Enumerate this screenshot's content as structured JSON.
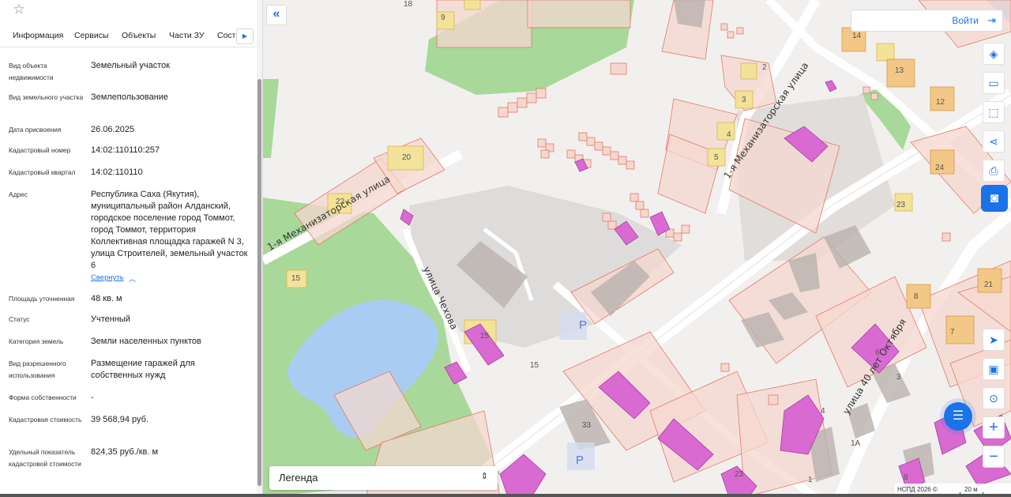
{
  "panel": {
    "tabs": [
      {
        "label": "Информация",
        "active": true
      },
      {
        "label": "Сервисы"
      },
      {
        "label": "Объекты"
      },
      {
        "label": "Части ЗУ"
      },
      {
        "label": "Соста"
      }
    ],
    "properties": [
      {
        "label": "Вид объекта недвижимости",
        "value": "Земельный участок"
      },
      {
        "label": "Вид земельного участка",
        "value": "Землепользование"
      },
      {
        "label": "Дата присвоения",
        "value": "26.06.2025"
      },
      {
        "label": "Кадастровый номер",
        "value": "14:02:110110:257"
      },
      {
        "label": "Кадастровый квартал",
        "value": "14:02:110110"
      },
      {
        "label": "Адрес",
        "value": "Республика Саха (Якутия), муниципальный район Алданский, городское поселение город Томмот, город Томмот, территория Коллективная площадка гаражей N 3, улица Строителей, земельный участок 6"
      },
      {
        "label": "Площадь уточненная",
        "value": "48 кв. м"
      },
      {
        "label": "Статус",
        "value": "Учтенный"
      },
      {
        "label": "Категория земель",
        "value": "Земли населенных пунктов"
      },
      {
        "label": "Вид разрешенного использования",
        "value": "Размещение гаражей для собственных нужд"
      },
      {
        "label": "Форма собственности",
        "value": "-"
      },
      {
        "label": "Кадастровая стоимость",
        "value": "39 568,94 руб."
      },
      {
        "label": "Удельный показатель кадастровой стоимости",
        "value": "824,35 руб./кв. м"
      }
    ],
    "collapse_link": "Свернуть"
  },
  "map": {
    "login_label": "Войти",
    "legend_label": "Легенда",
    "copyright": "НСПД 2026 ©",
    "scale": "20 м",
    "streets": {
      "mekh1": "1-я Механизаторская улица",
      "mekh2": "1-я Механизаторская улица",
      "chekhova": "улица Чехова",
      "oct": "улица 40 лет Октября"
    },
    "building_numbers": [
      "9",
      "18",
      "14",
      "13",
      "12",
      "2",
      "3",
      "4",
      "5",
      "20",
      "22",
      "24",
      "23",
      "21",
      "15",
      "15",
      "15",
      "8",
      "7",
      "6",
      "3",
      "4",
      "1А",
      "33",
      "23",
      "8",
      "1",
      "P",
      "P"
    ],
    "icons": {
      "star": "star-icon",
      "collapse": "double-chevron-left-icon",
      "login": "login-icon",
      "layers": "layers-icon",
      "ruler": "ruler-icon",
      "select_area": "select-area-icon",
      "share": "share-icon",
      "print": "print-icon",
      "widget": "widget-icon",
      "locate": "locate-icon",
      "minimap": "minimap-icon",
      "geo": "geo-icon",
      "zoom_in": "plus-icon",
      "zoom_out": "minus-icon",
      "chat": "chat-icon"
    }
  }
}
